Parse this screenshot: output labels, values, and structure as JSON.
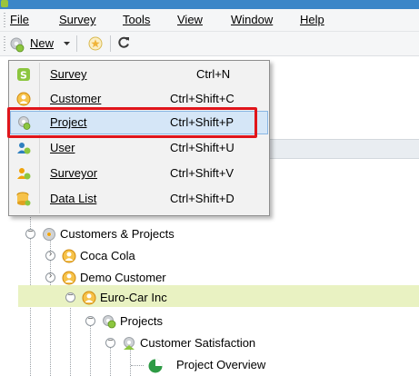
{
  "menubar": {
    "items": [
      {
        "label": "File"
      },
      {
        "label": "Survey"
      },
      {
        "label": "Tools"
      },
      {
        "label": "View"
      },
      {
        "label": "Window"
      },
      {
        "label": "Help"
      }
    ]
  },
  "toolbar": {
    "new_label": "New",
    "dropdown_icon": "chevron-down-icon",
    "favorite_icon": "star-icon",
    "refresh_icon": "refresh-icon"
  },
  "new_menu": {
    "items": [
      {
        "label": "Survey",
        "shortcut": "Ctrl+N",
        "icon": "survey-icon"
      },
      {
        "label": "Customer",
        "shortcut": "Ctrl+Shift+C",
        "icon": "customer-icon"
      },
      {
        "label": "Project",
        "shortcut": "Ctrl+Shift+P",
        "icon": "project-icon"
      },
      {
        "label": "User",
        "shortcut": "Ctrl+Shift+U",
        "icon": "user-icon"
      },
      {
        "label": "Surveyor",
        "shortcut": "Ctrl+Shift+V",
        "icon": "surveyor-icon"
      },
      {
        "label": "Data List",
        "shortcut": "Ctrl+Shift+D",
        "icon": "data-list-icon"
      }
    ],
    "selected": "Project",
    "highlight_color": "#e0151b"
  },
  "tree": {
    "nodes": [
      {
        "label": "Customers & Projects"
      },
      {
        "label": "Coca Cola"
      },
      {
        "label": "Demo Customer"
      },
      {
        "label": "Euro-Car Inc"
      },
      {
        "label": "Projects"
      },
      {
        "label": "Customer Satisfaction"
      },
      {
        "label": "Project Overview"
      }
    ],
    "selected": "Euro-Car Inc",
    "selected_color": "#e9f2c2"
  },
  "colors": {
    "accent_green": "#8cc63f",
    "customer_orange": "#f0a30a",
    "title_blue": "#3b86c8"
  }
}
